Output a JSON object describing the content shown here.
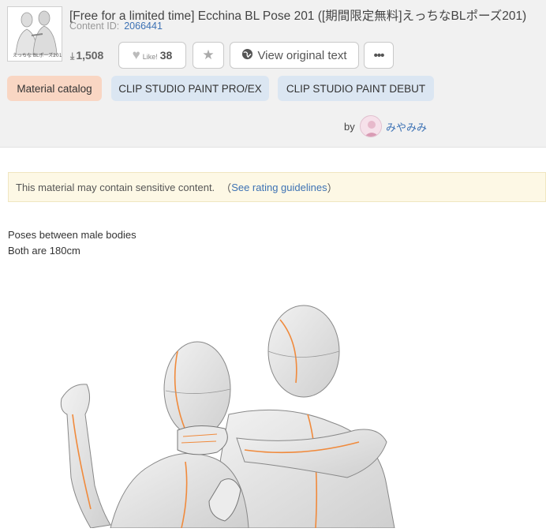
{
  "header": {
    "title": "[Free for a limited time] Ecchina BL Pose 201 ([期間限定無料]えっちなBLポーズ201)",
    "content_id_label": "Content ID:",
    "content_id": "2066441",
    "download_count": "1,508",
    "like_label": "Like!",
    "like_count": "38",
    "view_original_label": "View original text",
    "more_label": "•••",
    "thumbnail_caption": "えっちな BLポーズ201"
  },
  "tags": [
    "Material catalog",
    "CLIP STUDIO PAINT PRO/EX",
    "CLIP STUDIO PAINT DEBUT"
  ],
  "author": {
    "by_label": "by",
    "name": "みやみみ"
  },
  "notice": {
    "text": "This material may contain sensitive content.",
    "open_paren": "（",
    "link_text": "See rating guidelines",
    "close_paren": "）"
  },
  "description": {
    "line1": "Poses between male bodies",
    "line2": "Both are 180cm"
  },
  "icons": {
    "download": "download-icon",
    "like": "heart-icon",
    "favorite": "star-icon",
    "translate": "globe-icon",
    "more": "ellipsis-icon"
  },
  "colors": {
    "accent_link": "#3d72b4",
    "tag_material": "#f9d6c3",
    "tag_app": "#dbe6f2",
    "notice_bg": "#fdf8e5",
    "header_bg": "#f1f1f1"
  }
}
